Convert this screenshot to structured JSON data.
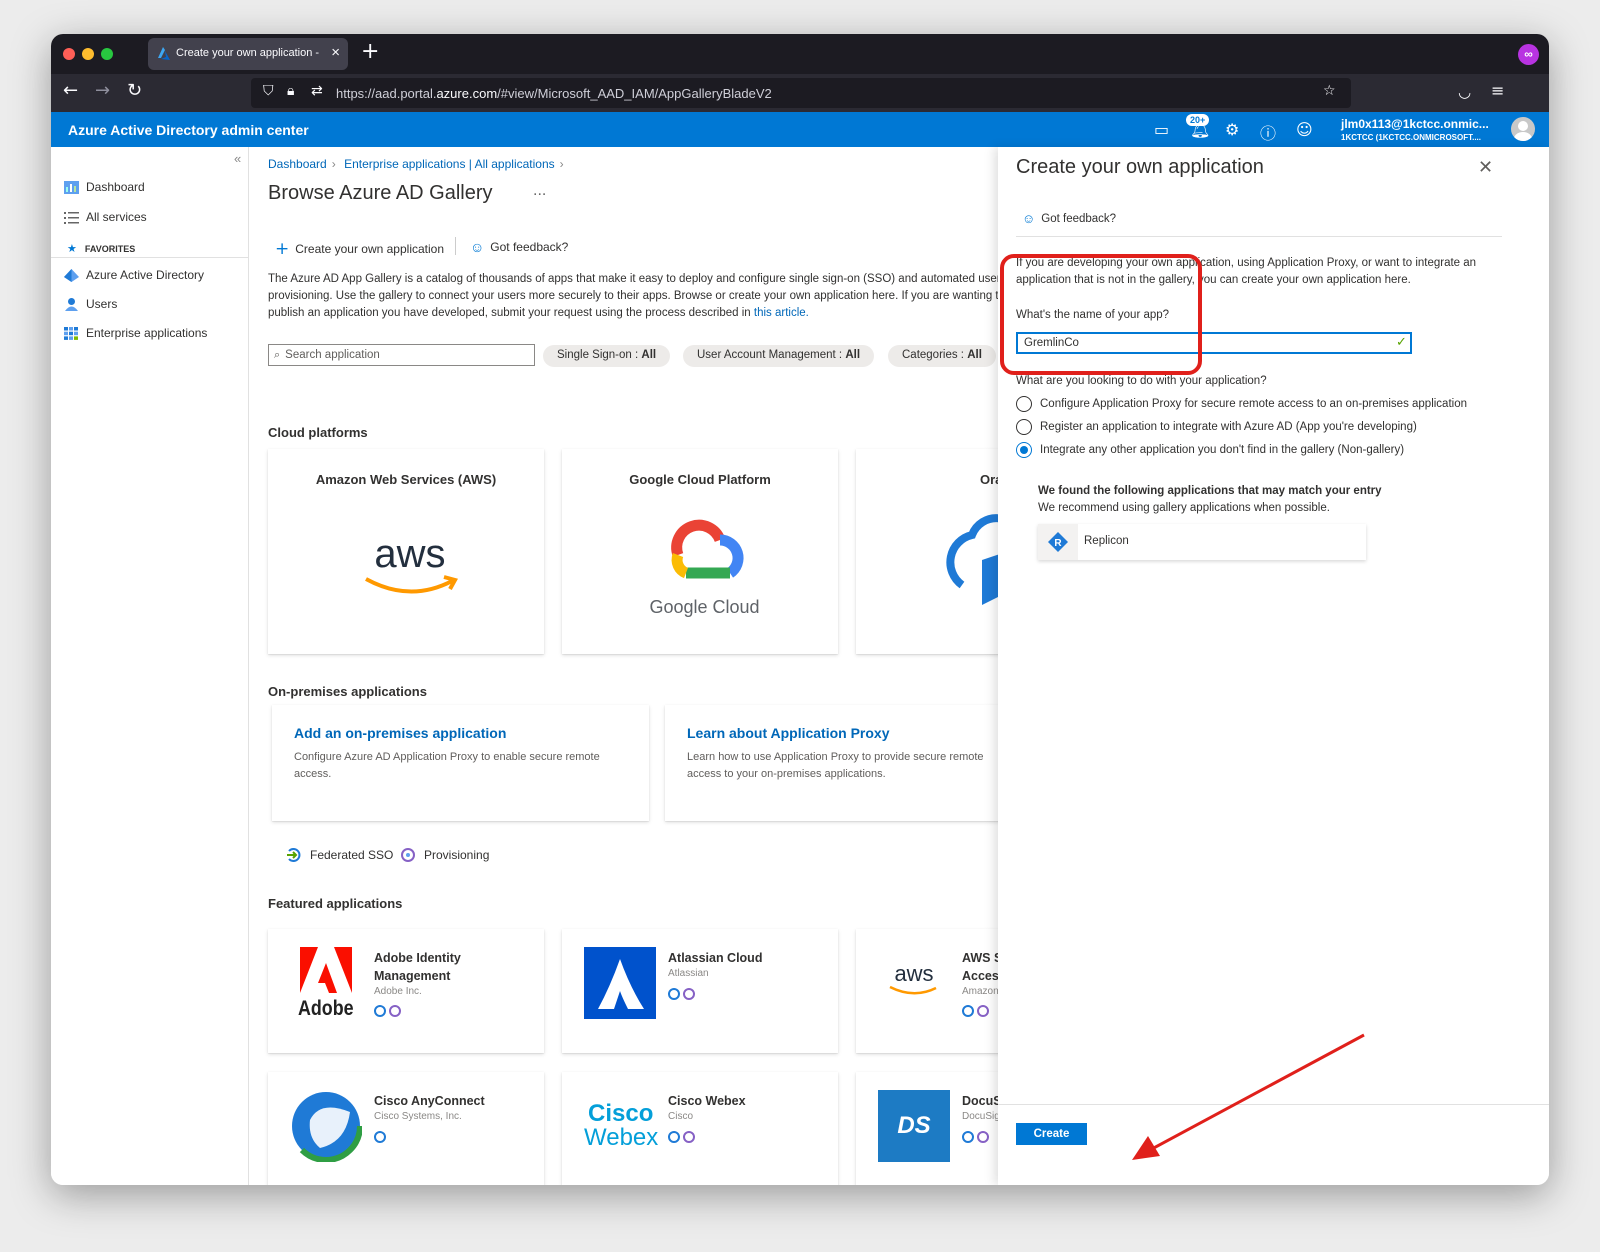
{
  "browser": {
    "tab_title": "Create your own application - Az",
    "url_prefix": "https://aad.portal.",
    "url_domain": "azure.com",
    "url_path": "/#view/Microsoft_AAD_IAM/AppGalleryBladeV2"
  },
  "header": {
    "title": "Azure Active Directory admin center",
    "notification_count": "20+",
    "account_name": "jlm0x113@1kctcc.onmic...",
    "account_tenant": "1KCTCC (1KCTCC.ONMICROSOFT...."
  },
  "sidebar": {
    "items": [
      {
        "label": "Dashboard"
      },
      {
        "label": "All services"
      }
    ],
    "favorites_label": "FAVORITES",
    "favorites": [
      {
        "label": "Azure Active Directory"
      },
      {
        "label": "Users"
      },
      {
        "label": "Enterprise applications"
      }
    ]
  },
  "main": {
    "breadcrumb": [
      "Dashboard",
      "Enterprise applications | All applications"
    ],
    "title": "Browse Azure AD Gallery",
    "more": "...",
    "cmd_create": "Create your own application",
    "cmd_feedback": "Got feedback?",
    "description": "The Azure AD App Gallery is a catalog of thousands of apps that make it easy to deploy and configure single sign-on (SSO) and automated user provisioning. Use the gallery to connect your users more securely to their apps. Browse or create your own application here. If you are wanting to publish an application you have developed, submit your request using the process described in",
    "description_link": "this article.",
    "search_placeholder": "Search application",
    "filters": [
      {
        "label": "Single Sign-on : ",
        "value": "All"
      },
      {
        "label": "User Account Management : ",
        "value": "All"
      },
      {
        "label": "Categories : ",
        "value": "All"
      }
    ],
    "cloud_title": "Cloud platforms",
    "cloud_cards": [
      "Amazon Web Services (AWS)",
      "Google Cloud Platform",
      "Oracle"
    ],
    "google_cloud_text": "Google Cloud",
    "onprem_title": "On-premises applications",
    "onprem_cards": [
      {
        "title": "Add an on-premises application",
        "desc": "Configure Azure AD Application Proxy to enable secure remote access."
      },
      {
        "title": "Learn about Application Proxy",
        "desc": "Learn how to use Application Proxy to provide secure remote access to your on-premises applications."
      }
    ],
    "legend_sso": "Federated SSO",
    "legend_prov": "Provisioning",
    "featured_title": "Featured applications",
    "featured": [
      {
        "name": "Adobe Identity Management",
        "publisher": "Adobe Inc."
      },
      {
        "name": "Atlassian Cloud",
        "publisher": "Atlassian"
      },
      {
        "name": "AWS Single-Account Access",
        "publisher": "Amazon"
      },
      {
        "name": "Cisco AnyConnect",
        "publisher": "Cisco Systems, Inc."
      },
      {
        "name": "Cisco Webex",
        "publisher": "Cisco"
      },
      {
        "name": "DocuSign",
        "publisher": "DocuSign"
      }
    ],
    "adobe_wordmark": "Adobe",
    "cisco_logo_1": "Cisco",
    "cisco_logo_2": "Webex",
    "ds_logo": "DS"
  },
  "panel": {
    "title": "Create your own application",
    "feedback": "Got feedback?",
    "intro": "If you are developing your own application, using Application Proxy, or want to integrate an application that is not in the gallery, you can create your own application here.",
    "name_question": "What's the name of your app?",
    "name_value": "GremlinCo",
    "purpose_question": "What are you looking to do with your application?",
    "options": [
      "Configure Application Proxy for secure remote access to an on-premises application",
      "Register an application to integrate with Azure AD (App you're developing)",
      "Integrate any other application you don't find in the gallery (Non-gallery)"
    ],
    "selected_option": 2,
    "match_heading": "We found the following applications that may match your entry",
    "match_sub": "We recommend using gallery applications when possible.",
    "match_app": "Replicon",
    "create_label": "Create"
  },
  "colors": {
    "azure_blue": "#0078d4",
    "annotation_red": "#e0201b"
  }
}
